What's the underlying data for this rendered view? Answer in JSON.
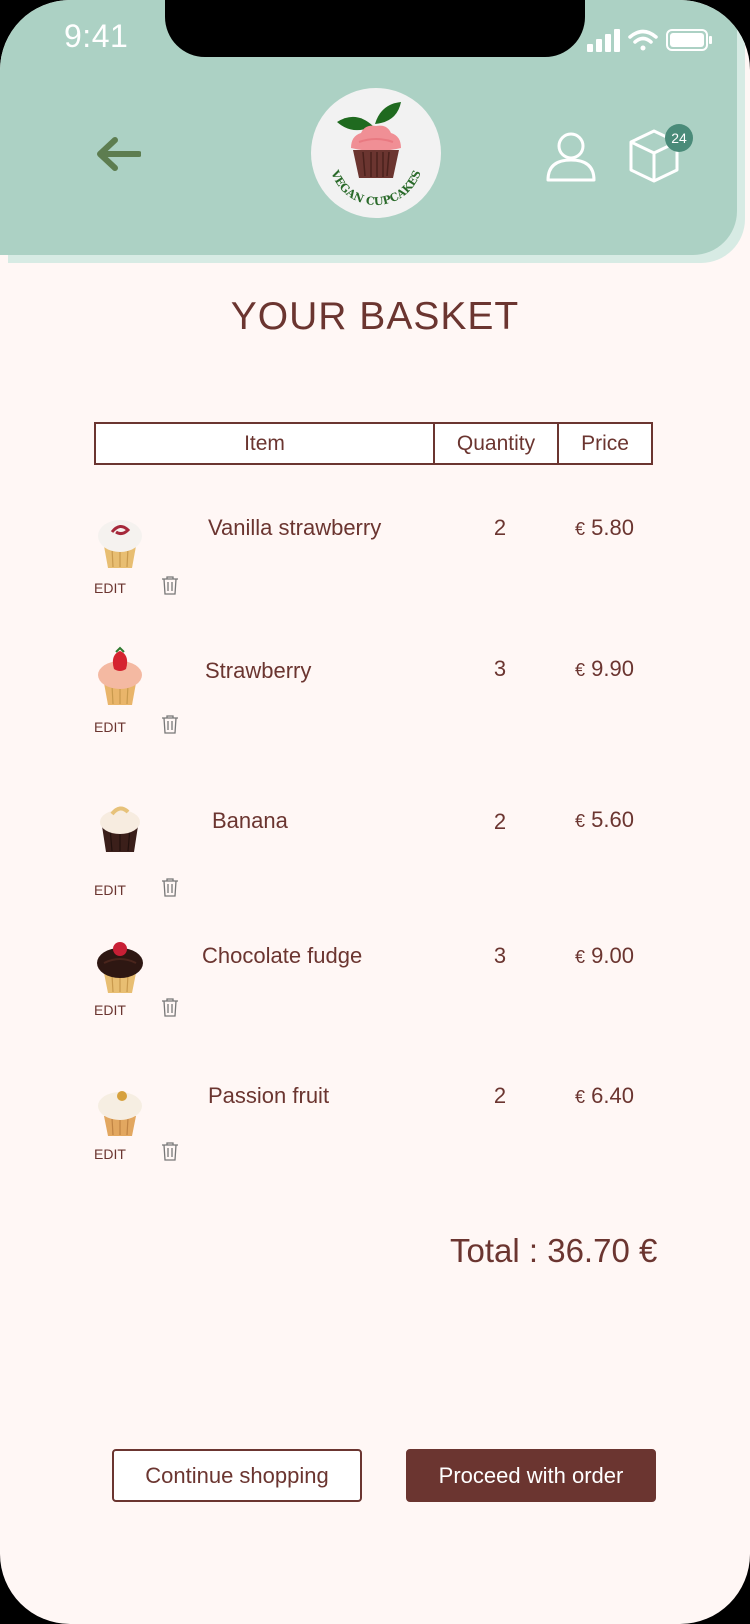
{
  "status_bar": {
    "time": "9:41"
  },
  "header": {
    "logo_text": "VEGAN CUPCAKES",
    "basket_count": "24"
  },
  "page_title": "YOUR BASKET",
  "table": {
    "headers": [
      "Item",
      "Quantity",
      "Price"
    ],
    "edit_label": "EDIT",
    "currency": "€",
    "rows": [
      {
        "name": "Vanilla strawberry",
        "quantity": "2",
        "price": "5.80"
      },
      {
        "name": "Strawberry",
        "quantity": "3",
        "price": "9.90"
      },
      {
        "name": "Banana",
        "quantity": "2",
        "price": "5.60"
      },
      {
        "name": "Chocolate fudge",
        "quantity": "3",
        "price": "9.00"
      },
      {
        "name": "Passion fruit",
        "quantity": "2",
        "price": "6.40"
      }
    ]
  },
  "total": "Total : 36.70 €",
  "buttons": {
    "continue": "Continue shopping",
    "proceed": "Proceed with order"
  },
  "colors": {
    "header_bg": "#acd1c4",
    "accent": "#6b3530",
    "badge": "#4a8b79",
    "page_bg": "#fff7f5"
  }
}
